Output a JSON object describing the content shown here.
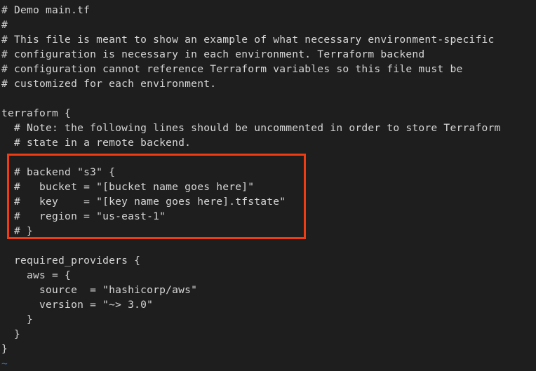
{
  "editor": {
    "app": "vim",
    "background_color": "#1e1e1e",
    "text_color": "#d6d6d6",
    "tilde_color": "#2f6fc4",
    "annotation_color": "#f03c13",
    "file_title": "Demo main.tf"
  },
  "code": {
    "lines": [
      "# Demo main.tf",
      "#",
      "# This file is meant to show an example of what necessary environment-specific",
      "# configuration is necessary in each environment. Terraform backend",
      "# configuration cannot reference Terraform variables so this file must be",
      "# customized for each environment.",
      "",
      "terraform {",
      "  # Note: the following lines should be uncommented in order to store Terraform",
      "  # state in a remote backend.",
      "",
      "  # backend \"s3\" {",
      "  #   bucket = \"[bucket name goes here]\"",
      "  #   key    = \"[key name goes here].tfstate\"",
      "  #   region = \"us-east-1\"",
      "  # }",
      "",
      "  required_providers {",
      "    aws = {",
      "      source  = \"hashicorp/aws\"",
      "      version = \"~> 3.0\"",
      "    }",
      "  }",
      "}"
    ],
    "empty_buffer_marker": "~"
  },
  "annotation": {
    "label": "backend-s3-block-highlight",
    "highlighted_lines": [
      "  # backend \"s3\" {",
      "  #   bucket = \"[bucket name goes here]\"",
      "  #   key    = \"[key name goes here].tfstate\"",
      "  #   region = \"us-east-1\"",
      "  # }"
    ]
  }
}
